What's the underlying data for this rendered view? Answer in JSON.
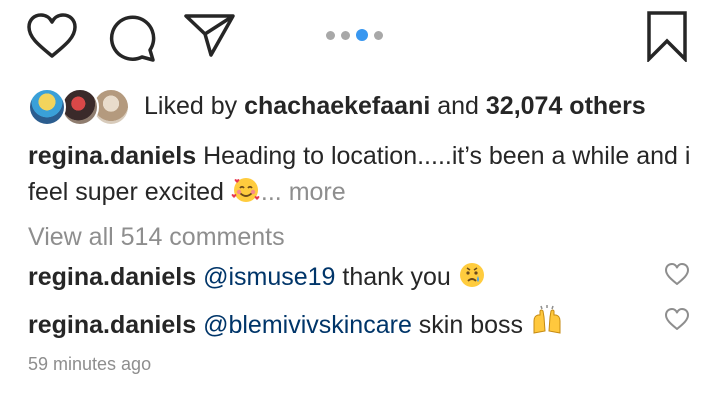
{
  "actions": {
    "icons": [
      "heart-icon",
      "comment-icon",
      "share-icon",
      "bookmark-icon"
    ],
    "carousel": {
      "count": 4,
      "active_index": 2,
      "active_color": "#3897f0",
      "inactive_color": "#a8a8a8"
    }
  },
  "likes": {
    "prefix": "Liked by ",
    "user": "chachaekefaani",
    "middle": " and ",
    "others": "32,074 others"
  },
  "caption": {
    "username": "regina.daniels",
    "text": "Heading to location.....it’s been a while and i feel super excited ",
    "emoji": "smiling-face-with-hearts",
    "more": "... more"
  },
  "view_all": "View all 514 comments",
  "comments": [
    {
      "username": "regina.daniels",
      "mention": "@ismuse19",
      "text": " thank you ",
      "emoji": "crying-face"
    },
    {
      "username": "regina.daniels",
      "mention": "@blemivivskincare",
      "text": " skin boss ",
      "emoji": "raising-hands"
    }
  ],
  "timestamp": "59 minutes ago",
  "colors": {
    "text": "#262626",
    "secondary": "#8e8e8e",
    "mention": "#003569"
  }
}
